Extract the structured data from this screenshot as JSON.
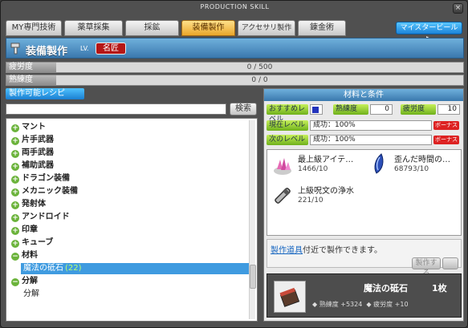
{
  "window": {
    "title": "PRODUCTION SKILL"
  },
  "tabs": [
    {
      "label": "MY専門技術"
    },
    {
      "label": "薬草採集"
    },
    {
      "label": "採鉱"
    },
    {
      "label": "装備製作",
      "active": true
    },
    {
      "label": "アクセサリ製作"
    },
    {
      "label": "錬金術"
    }
  ],
  "meister_button": "マイスタービール ▶",
  "skill": {
    "title": "装備製作",
    "lv_label": "LV.",
    "rank": "名匠"
  },
  "fatigue": {
    "label": "疲労度",
    "value": "0 / 500"
  },
  "proficiency": {
    "label": "熟練度",
    "value": "0 / 0"
  },
  "recipe_header": "製作可能レシピ",
  "search": {
    "button": "検索",
    "value": ""
  },
  "categories": [
    {
      "label": "マント"
    },
    {
      "label": "片手武器"
    },
    {
      "label": "両手武器"
    },
    {
      "label": "補助武器"
    },
    {
      "label": "ドラゴン装備"
    },
    {
      "label": "メカニック装備"
    },
    {
      "label": "発射体"
    },
    {
      "label": "アンドロイド"
    },
    {
      "label": "印章"
    },
    {
      "label": "キューブ"
    },
    {
      "label": "材料",
      "expanded": true
    },
    {
      "label": "分解",
      "expanded": true
    }
  ],
  "sub_items": {
    "selected": {
      "label": "魔法の砥石",
      "count": "(22)"
    },
    "decompose": {
      "label": "分解"
    }
  },
  "conditions": {
    "header": "材料と条件",
    "recommended_level_label": "おすすめレベル",
    "proficiency_label": "熟練度",
    "proficiency_value": "0",
    "fatigue_label": "疲労度",
    "fatigue_value": "10",
    "current_level_label": "現在レベル",
    "current_level_value": "成功：100%",
    "next_level_label": "次のレベル",
    "next_level_value": "成功：100%",
    "bonus_label": "ボーナス"
  },
  "materials": [
    {
      "name": "最上級アイテ…",
      "qty": "1466/10",
      "icon": "crystal-cluster-icon"
    },
    {
      "name": "歪んだ時間の…",
      "qty": "68793/10",
      "icon": "blue-shard-icon"
    },
    {
      "name": "上級呪文の浄水",
      "qty": "221/10",
      "icon": "vial-icon"
    }
  ],
  "description": {
    "link": "製作道具",
    "text": "付近で製作できます。"
  },
  "make_button": "製作する",
  "result": {
    "name": "魔法の砥石",
    "count": "1枚",
    "proficiency_label": "熟練度",
    "proficiency_value": "+5324",
    "fatigue_label": "疲労度",
    "fatigue_value": "+10"
  },
  "colors": {
    "accent": "#3a78ad",
    "active_tab": "#e9a62b",
    "rank_badge": "#b51616",
    "selected": "#3f9be0"
  }
}
